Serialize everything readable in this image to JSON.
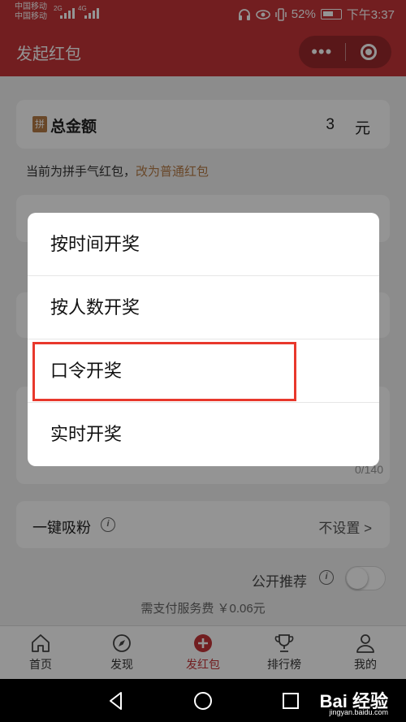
{
  "status_bar": {
    "carrier1": "中国移动",
    "carrier2": "中国移动",
    "signal1_tag": "2G",
    "signal2_tag": "4G",
    "battery": "52%",
    "time": "下午3:37"
  },
  "title_bar": {
    "title": "发起红包",
    "more_icon": "•••"
  },
  "amount": {
    "badge": "拼",
    "label": "总金额",
    "value": "3",
    "unit": "元"
  },
  "hint": {
    "text": "当前为拼手气红包，",
    "link": "改为普通红包"
  },
  "message": {
    "counter": "0/140"
  },
  "follow": {
    "label": "一键吸粉",
    "value": "不设置 >"
  },
  "public": {
    "label": "公开推荐",
    "enabled": false
  },
  "fee": "需支付服务费 ￥0.06元",
  "tabs": [
    {
      "label": "首页",
      "icon": "home-icon",
      "active": false
    },
    {
      "label": "发现",
      "icon": "compass-icon",
      "active": false
    },
    {
      "label": "发红包",
      "icon": "plus-circle-icon",
      "active": true
    },
    {
      "label": "排行榜",
      "icon": "trophy-icon",
      "active": false
    },
    {
      "label": "我的",
      "icon": "person-icon",
      "active": false
    }
  ],
  "dialog": {
    "options": [
      "按时间开奖",
      "按人数开奖",
      "口令开奖",
      "实时开奖"
    ],
    "highlighted_index": 2
  },
  "watermark": {
    "main": "Bai 经验",
    "sub": "jingyan.baidu.com"
  },
  "colors": {
    "brand_red": "#c53438",
    "link_brown": "#b57a46",
    "highlight_red": "#e8382c"
  }
}
